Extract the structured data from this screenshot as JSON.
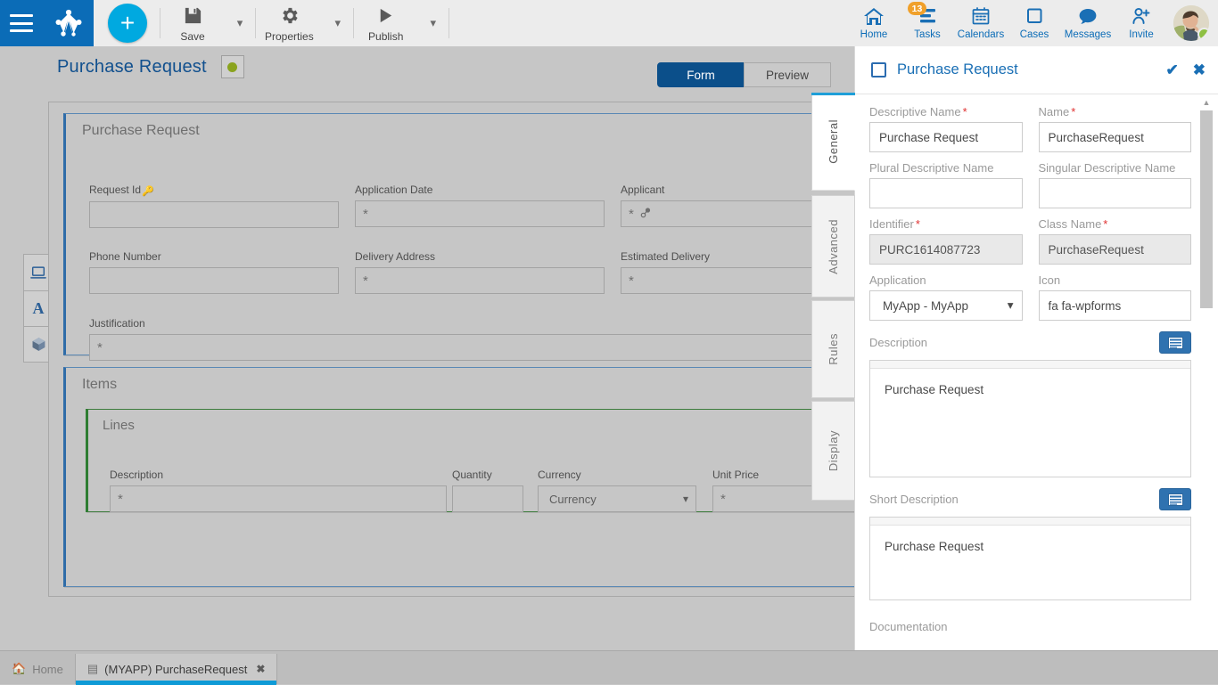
{
  "topbar": {
    "menu_icon": "hamburger-menu-icon",
    "logo_icon": "bizagi-crown-logo",
    "add_label": "+",
    "tools": [
      {
        "label": "Save",
        "icon": "floppy-save-icon",
        "has_caret": true
      },
      {
        "label": "Properties",
        "icon": "gear-icon",
        "has_caret": true
      },
      {
        "label": "Publish",
        "icon": "play-triangle-icon",
        "has_caret": true
      }
    ],
    "nav": [
      {
        "label": "Home",
        "icon": "home-icon",
        "badge": null
      },
      {
        "label": "Tasks",
        "icon": "tasks-list-icon",
        "badge": "13"
      },
      {
        "label": "Calendars",
        "icon": "calendar-icon",
        "badge": null
      },
      {
        "label": "Cases",
        "icon": "square-cases-icon",
        "badge": null
      },
      {
        "label": "Messages",
        "icon": "speech-bubble-icon",
        "badge": null
      },
      {
        "label": "Invite",
        "icon": "person-add-icon",
        "badge": null
      }
    ],
    "avatar": {
      "name": "avatar",
      "status": "online"
    }
  },
  "page": {
    "title": "Purchase Request",
    "status_dot_color": "#8aa31e",
    "mode_tabs": [
      {
        "label": "Form",
        "active": true
      },
      {
        "label": "Preview",
        "active": false
      }
    ]
  },
  "mini_toolbox": [
    {
      "icon": "display-device-icon"
    },
    {
      "icon": "letter-a-text-icon"
    },
    {
      "icon": "cube-3d-icon"
    }
  ],
  "side_tabs": [
    {
      "label": "General",
      "active": true
    },
    {
      "label": "Advanced",
      "active": false
    },
    {
      "label": "Rules",
      "active": false
    },
    {
      "label": "Display",
      "active": false
    }
  ],
  "form": {
    "main_panel_title": "Purchase Request",
    "fields": [
      {
        "label": "Request Id",
        "key": true,
        "value": "",
        "placeholder": ""
      },
      {
        "label": "Application Date",
        "value": "",
        "placeholder": "*"
      },
      {
        "label": "Applicant",
        "value": "",
        "placeholder": "*"
      },
      {
        "label": "Phone Number",
        "value": "",
        "placeholder": ""
      },
      {
        "label": "Delivery Address",
        "value": "",
        "placeholder": "*"
      },
      {
        "label": "Estimated Delivery",
        "value": "",
        "placeholder": "*"
      },
      {
        "label": "Justification",
        "value": "",
        "placeholder": "*"
      }
    ],
    "items_panel_title": "Items",
    "lines_panel_title": "Lines",
    "line_fields": [
      {
        "label": "Description",
        "value": "",
        "placeholder": "*"
      },
      {
        "label": "Quantity",
        "value": "",
        "placeholder": ""
      },
      {
        "label": "Currency",
        "value": "Currency",
        "type": "select"
      },
      {
        "label": "Unit Price",
        "value": "",
        "placeholder": "*"
      }
    ]
  },
  "properties": {
    "header_title": "Purchase Request",
    "confirm_icon": "check-icon",
    "cancel_icon": "close-x-icon",
    "descriptive_name": {
      "label": "Descriptive Name",
      "required": true,
      "value": "Purchase Request"
    },
    "name": {
      "label": "Name",
      "required": true,
      "value": "PurchaseRequest"
    },
    "plural_descriptive_name": {
      "label": "Plural Descriptive Name",
      "required": false,
      "value": ""
    },
    "singular_descriptive_name": {
      "label": "Singular Descriptive Name",
      "required": false,
      "value": ""
    },
    "identifier": {
      "label": "Identifier",
      "required": true,
      "value": "PURC1614087723"
    },
    "class_name": {
      "label": "Class Name",
      "required": true,
      "value": "PurchaseRequest"
    },
    "application": {
      "label": "Application",
      "required": false,
      "value": "MyApp - MyApp"
    },
    "icon": {
      "label": "Icon",
      "required": false,
      "value": "fa fa-wpforms"
    },
    "description": {
      "label": "Description",
      "value": "Purchase Request",
      "button_icon": "rich-text-editor-icon"
    },
    "short_description": {
      "label": "Short Description",
      "value": "Purchase Request",
      "button_icon": "rich-text-editor-icon"
    },
    "documentation": {
      "label": "Documentation"
    }
  },
  "taskbar": {
    "tabs": [
      {
        "label": "Home",
        "icon": "home-icon",
        "active": false,
        "closable": false
      },
      {
        "label": "(MYAPP) PurchaseRequest",
        "icon": "form-doc-icon",
        "active": true,
        "closable": true,
        "close_icon": "close-x-icon"
      }
    ]
  },
  "colors": {
    "brand_blue": "#0b6cb7",
    "accent_cyan": "#00a9e0",
    "canvas_gray": "#c6c6c6",
    "badge_orange": "#f0a02a",
    "panel_blue_border": "#2f6ca8",
    "lines_green_border": "#2e7d32",
    "status_green": "#8aa31e",
    "required_red": "#e03131"
  }
}
